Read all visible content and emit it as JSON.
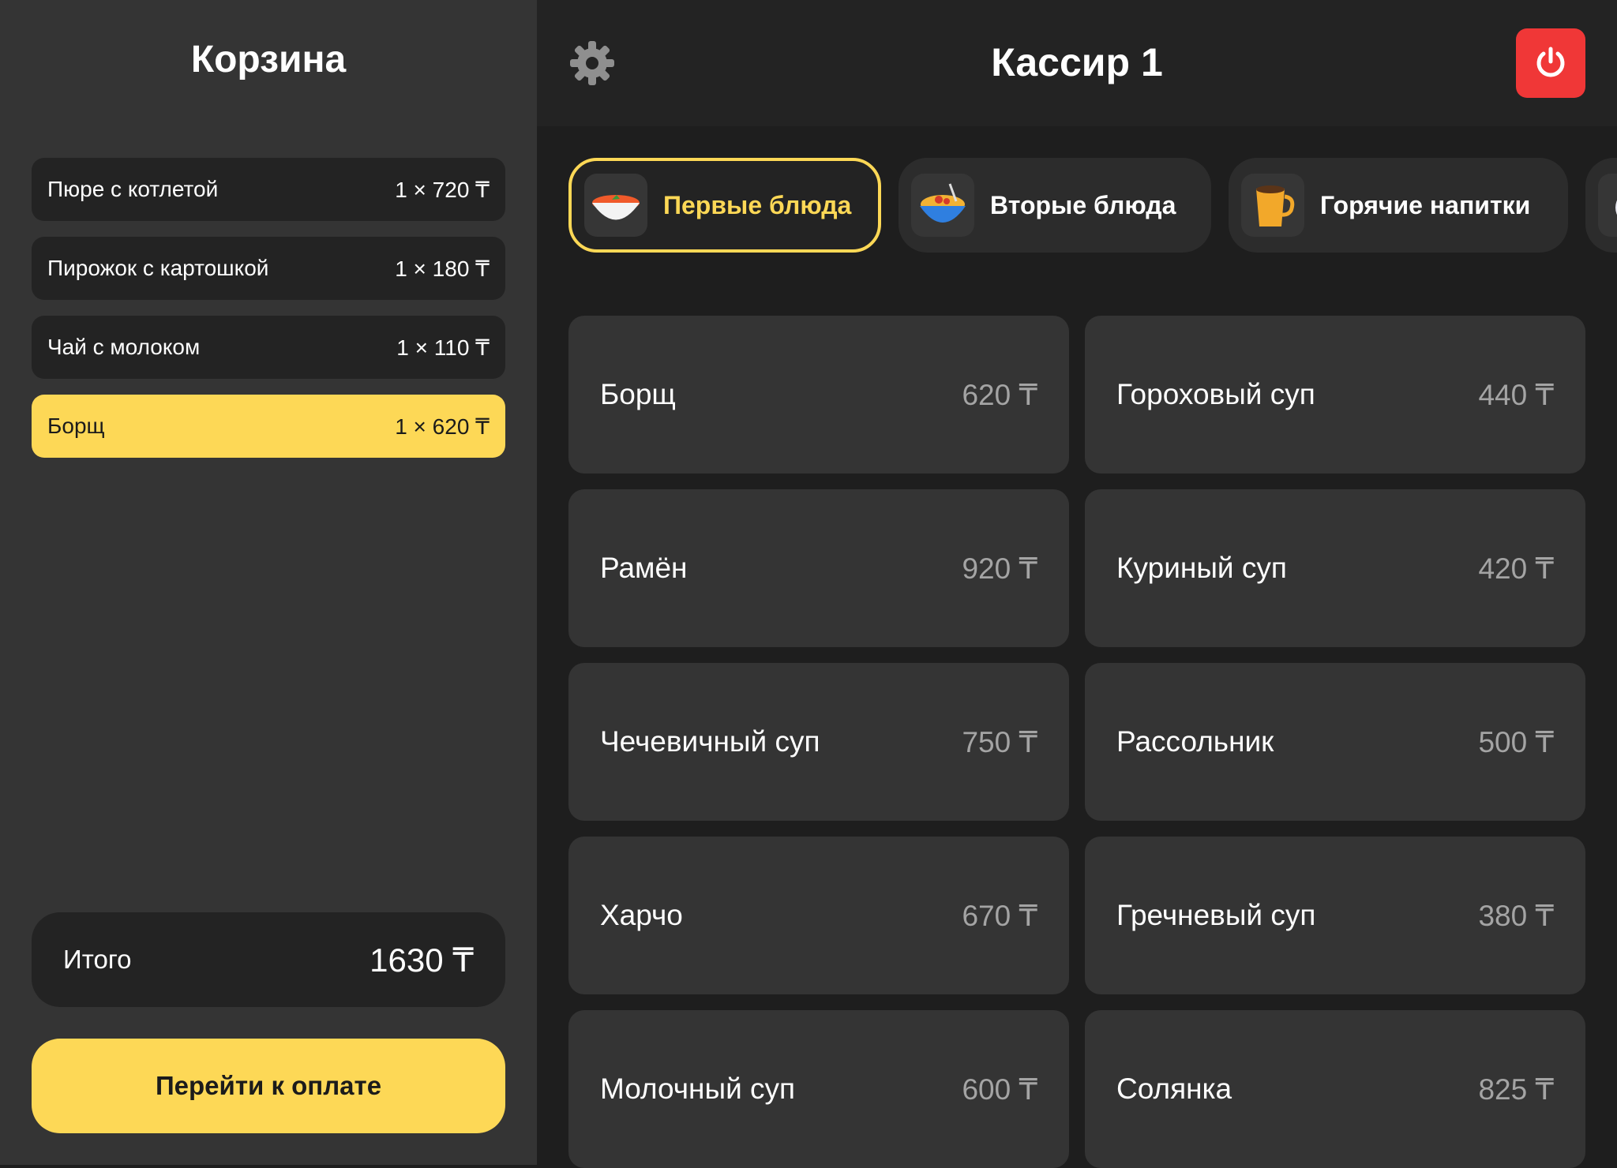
{
  "cart": {
    "title": "Корзина",
    "items": [
      {
        "name": "Пюре с котлетой",
        "qty": "1 × 720 ₸"
      },
      {
        "name": "Пирожок с картошкой",
        "qty": "1 × 180 ₸"
      },
      {
        "name": "Чай с молоком",
        "qty": "1 × 110 ₸"
      },
      {
        "name": "Борщ",
        "qty": "1 × 620 ₸"
      }
    ],
    "total_label": "Итого",
    "total_value": "1630 ₸",
    "pay_label": "Перейти к оплате"
  },
  "header": {
    "title": "Кассир 1",
    "settings_icon": "gear-icon",
    "power_icon": "power-icon"
  },
  "categories": [
    {
      "label": "Первые блюда",
      "icon": "soup-bowl-icon",
      "active": true
    },
    {
      "label": "Вторые блюда",
      "icon": "pasta-bowl-icon",
      "active": false
    },
    {
      "label": "Горячие напитки",
      "icon": "coffee-mug-icon",
      "active": false
    }
  ],
  "products": [
    {
      "name": "Борщ",
      "price": "620 ₸"
    },
    {
      "name": "Гороховый суп",
      "price": "440 ₸"
    },
    {
      "name": "Рамён",
      "price": "920 ₸"
    },
    {
      "name": "Куриный суп",
      "price": "420 ₸"
    },
    {
      "name": "Чечевичный суп",
      "price": "750 ₸"
    },
    {
      "name": "Рассольник",
      "price": "500 ₸"
    },
    {
      "name": "Харчо",
      "price": "670 ₸"
    },
    {
      "name": "Гречневый суп",
      "price": "380 ₸"
    },
    {
      "name": "Молочный суп",
      "price": "600 ₸"
    },
    {
      "name": "Солянка",
      "price": "825 ₸"
    }
  ],
  "colors": {
    "accent": "#fdd856",
    "danger": "#f03737",
    "panel": "#343434",
    "background": "#1e1e1e"
  }
}
